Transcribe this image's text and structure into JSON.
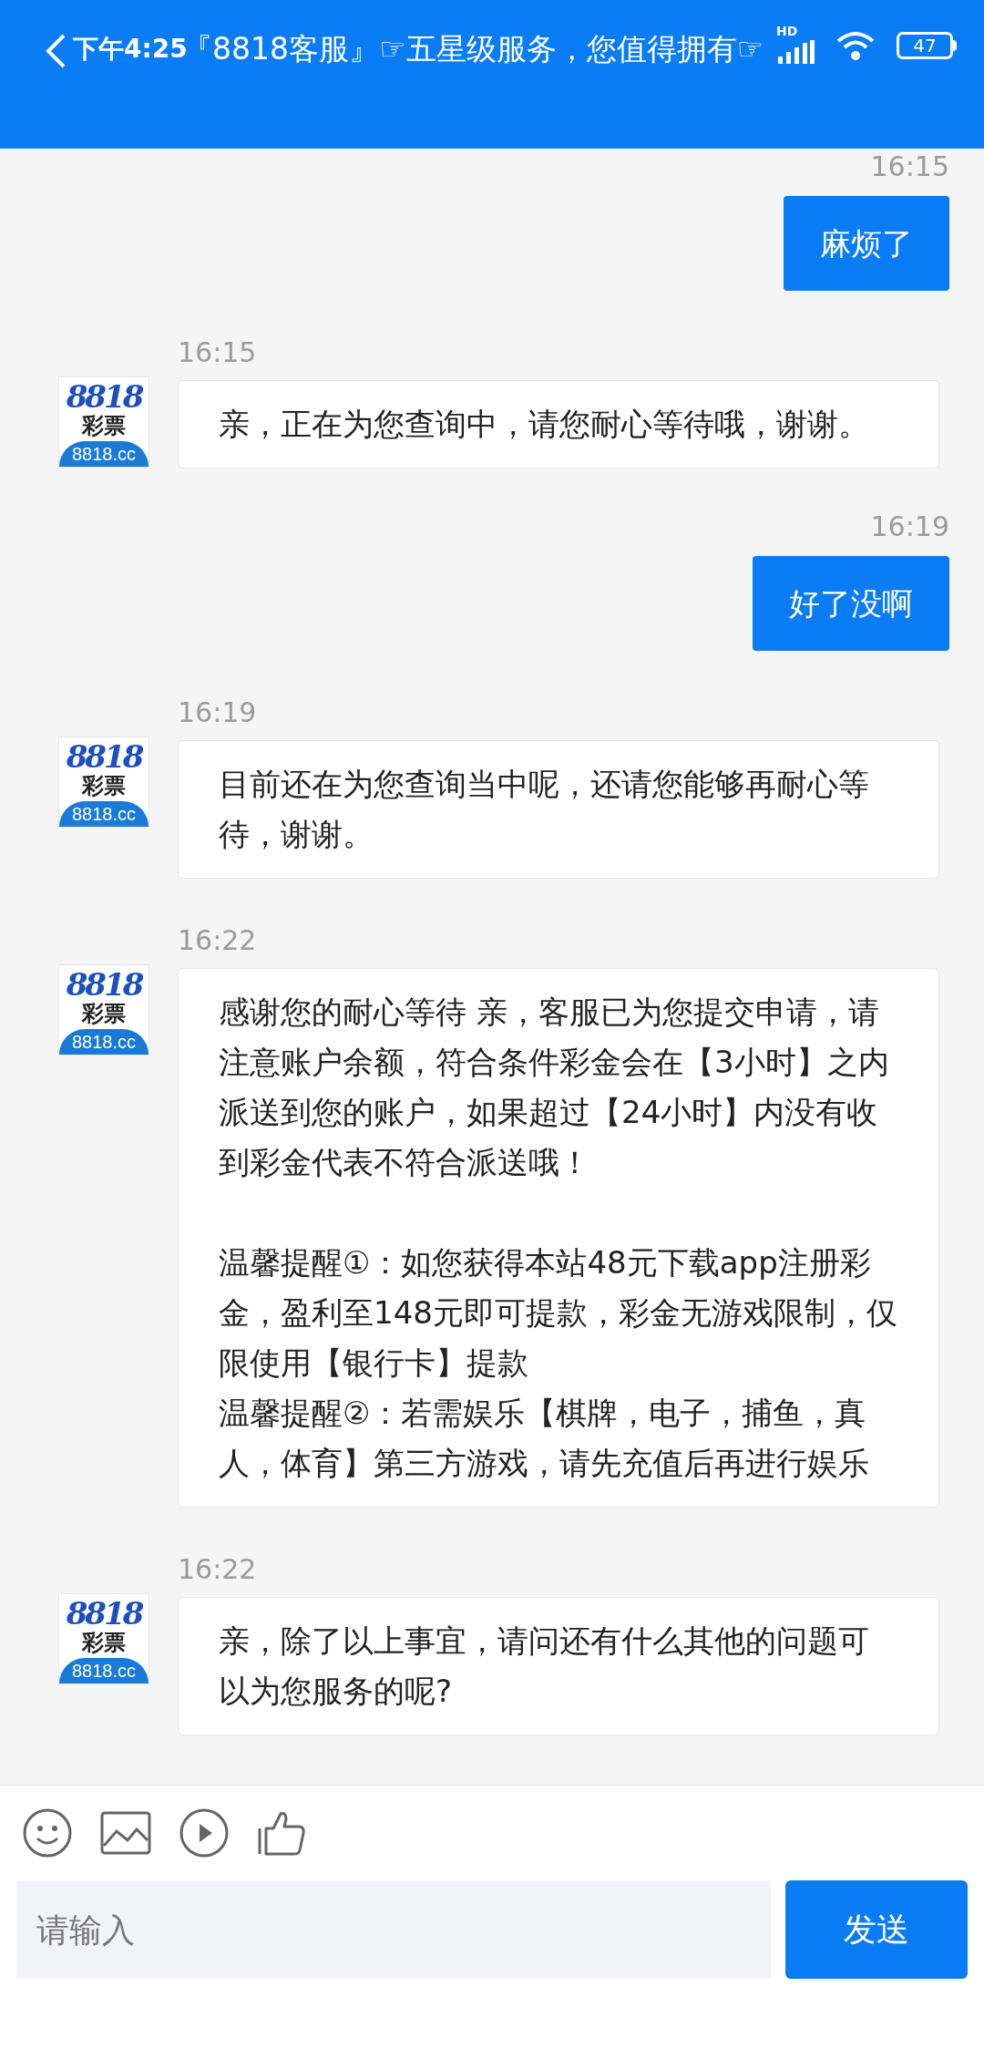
{
  "status_bar": {
    "time": "下午4:25",
    "signal_label": "HD",
    "battery": "47"
  },
  "header": {
    "title": "『8818客服』☞五星级服务，您值得拥有☞"
  },
  "messages": [
    {
      "kind": "outgoing",
      "time": "16:15",
      "blocks": [
        [
          "麻烦了"
        ]
      ]
    },
    {
      "kind": "incoming",
      "time": "16:15",
      "avatar": [
        "8818",
        "彩票",
        "8818.cc"
      ],
      "blocks": [
        [
          "亲，正在为您查询中，请您耐心等待哦，谢谢。"
        ]
      ]
    },
    {
      "kind": "outgoing",
      "time": "16:19",
      "blocks": [
        [
          "好了没啊"
        ]
      ]
    },
    {
      "kind": "incoming",
      "time": "16:19",
      "avatar": [
        "8818",
        "彩票",
        "8818.cc"
      ],
      "blocks": [
        [
          "目前还在为您查询当中呢，还请您能够再耐心等待，谢谢。"
        ]
      ]
    },
    {
      "kind": "incoming",
      "time": "16:22",
      "avatar": [
        "8818",
        "彩票",
        "8818.cc"
      ],
      "blocks": [
        [
          "感谢您的耐心等待 亲，客服已为您提交申请，请注意账户余额，符合条件彩金会在【3小时】之内派送到您的账户，如果超过【24小时】内没有收到彩金代表不符合派送哦！"
        ],
        [
          "温馨提醒①：如您获得本站48元下载app注册彩金，盈利至148元即可提款，彩金无游戏限制，仅限使用【银行卡】提款",
          "温馨提醒②：若需娱乐【棋牌，电子，捕鱼，真人，体育】第三方游戏，请先充值后再进行娱乐"
        ]
      ]
    },
    {
      "kind": "incoming",
      "time": "16:22",
      "avatar": [
        "8818",
        "彩票",
        "8818.cc"
      ],
      "blocks": [
        [
          "亲，除了以上事宜，请问还有什么其他的问题可以为您服务的呢?"
        ]
      ]
    }
  ],
  "composer": {
    "placeholder": "请输入",
    "send": "发送"
  }
}
